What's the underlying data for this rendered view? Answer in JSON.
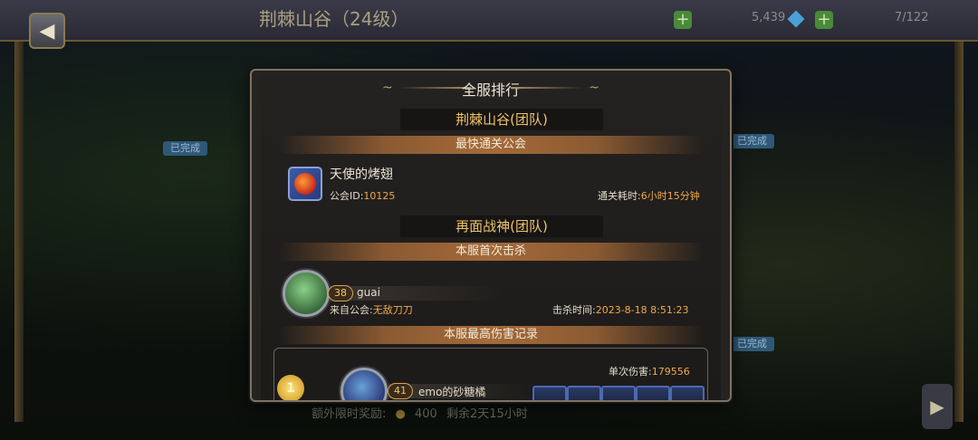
{
  "background": {
    "stage_title": "荆棘山谷（24级）",
    "resource_count": "5,439",
    "stamina": "7/122",
    "badges": [
      "已完成",
      "已完成",
      "已完成"
    ],
    "reward_text": "额外限时奖励:",
    "reward_amount": "400",
    "reward_time": "剩余2天15小时",
    "icons": {
      "back": "back-arrow-icon",
      "gem": "gem-icon",
      "next": "chevron-right-icon"
    }
  },
  "modal": {
    "title": "全服排行",
    "section1": {
      "header": "荆棘山谷(团队)",
      "band": "最快通关公会",
      "guild_name": "天使的烤翅",
      "guild_id_label": "公会ID:",
      "guild_id": "10125",
      "time_label": "通关耗时:",
      "time_value": "6小时15分钟"
    },
    "section2": {
      "header": "再面战神(团队)",
      "band": "本服首次击杀",
      "level": "38",
      "player_name": "guai",
      "from_guild_label": "来自公会:",
      "from_guild": "无敌刀刀",
      "kill_time_label": "击杀时间:",
      "kill_time": "2023-8-18 8:51:23"
    },
    "section3": {
      "band": "本服最高伤害记录",
      "medal": "1",
      "damage_label": "单次伤害:",
      "damage_value": "179556",
      "level": "41",
      "player_name": "emo的砂糖橘"
    },
    "colors": {
      "accent": "#f0a94a",
      "header_text": "#f0c469",
      "band": "#a46a3a"
    }
  }
}
